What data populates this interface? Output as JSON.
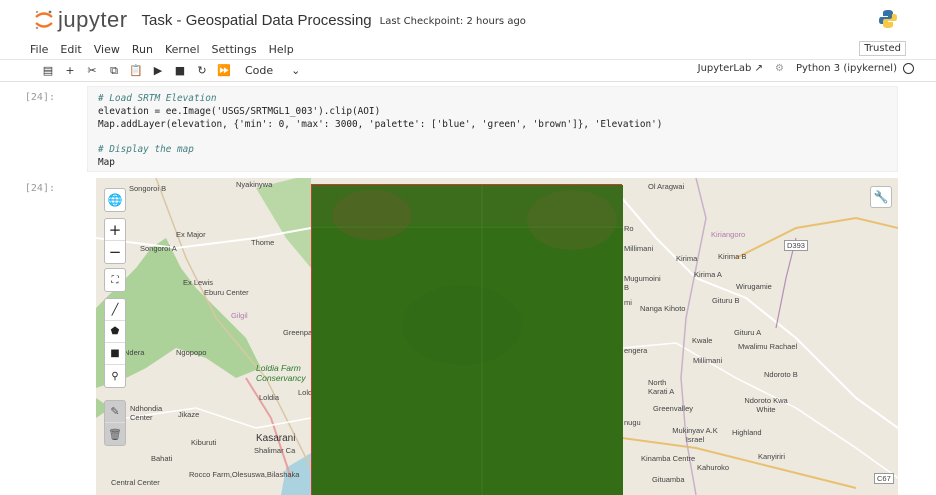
{
  "header": {
    "logo_text": "jupyter",
    "notebook_title": "Task - Geospatial Data Processing",
    "checkpoint": "Last Checkpoint: 2 hours ago"
  },
  "menu": {
    "items": [
      "File",
      "Edit",
      "View",
      "Run",
      "Kernel",
      "Settings",
      "Help"
    ],
    "trusted": "Trusted"
  },
  "toolbar": {
    "cell_type": "Code",
    "jupyterlab": "JupyterLab",
    "kernel_name": "Python 3 (ipykernel)"
  },
  "cells": {
    "input_prompt": "[24]:",
    "output_prompt": "[24]:",
    "code_lines": [
      {
        "comment": "# Load SRTM Elevation"
      },
      {
        "code": "elevation = ee.Image('USGS/SRTMGL1_003').clip(AOI)"
      },
      {
        "code": "Map.addLayer(elevation, {'min': 0, 'max': 3000, 'palette': ['blue', 'green', 'brown']}, 'Elevation')"
      },
      {
        "code": ""
      },
      {
        "comment": "# Display the map"
      },
      {
        "code": "Map"
      }
    ]
  },
  "map": {
    "labels": [
      "Songoroi B",
      "Nyakinywa",
      "Ex Major",
      "Thome",
      "Songoroi A",
      "Ex Lewis",
      "Eburu Center",
      "Gilgil",
      "Greenpa",
      "Ndera",
      "Ngopopo",
      "Loldia Farm Conservancy",
      "Loldia",
      "Lold",
      "Ndhondia Center",
      "Jikaze",
      "Kiburuti",
      "Kasarani",
      "Shalimar Ca",
      "Bahati",
      "Rocco Farm,Olesuswa,Bilashaka",
      "Central Center",
      "Ol Aragwai",
      "Kiriangoro",
      "D393",
      "Millimani",
      "Kirima",
      "Kirima B",
      "Mugumoini B",
      "Kirima A",
      "Wirugamie",
      "Gituru B",
      "Nanga Kihoto",
      "Gituru A",
      "Kwale",
      "Mwalimu Rachael",
      "Millimani",
      "Ndoroto B",
      "engera",
      "North Karati A",
      "Ndoroto Kwa White",
      "Greenvalley",
      "Mukinyav A.K Israel",
      "Highland",
      "Kanyiriri",
      "Kinamba Centre",
      "Kahuroko",
      "Gituamba",
      "C67",
      "Ro",
      "nugu",
      "mi"
    ],
    "layer_color": "#2d6a0e",
    "layer_border": "#c0392b"
  }
}
